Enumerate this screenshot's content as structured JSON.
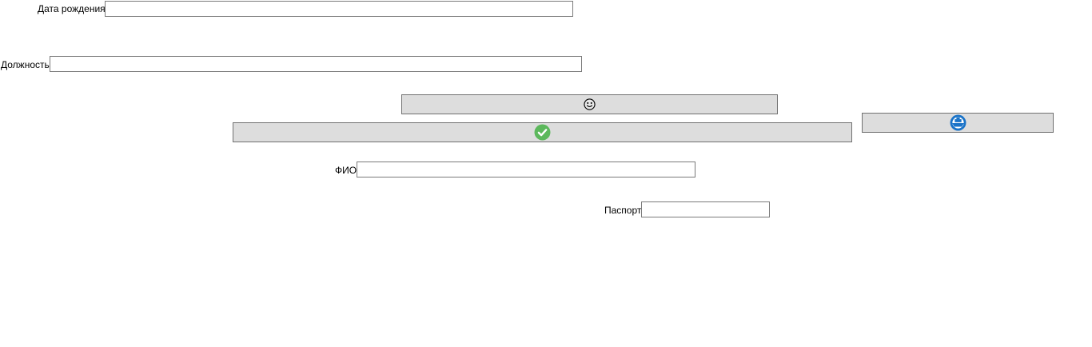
{
  "form": {
    "birth_date": {
      "label": "Дата рождения",
      "value": ""
    },
    "position": {
      "label": "Должность",
      "value": ""
    },
    "full_name": {
      "label": "ФИО",
      "value": ""
    },
    "passport": {
      "label": "Паспорт",
      "value": ""
    }
  },
  "buttons": {
    "face": {
      "icon": "smiley-face-icon"
    },
    "confirm": {
      "icon": "green-checkmark-icon",
      "color": "#5cb85c"
    },
    "ship": {
      "icon": "blue-ship-icon",
      "color": "#1a73c8"
    }
  }
}
